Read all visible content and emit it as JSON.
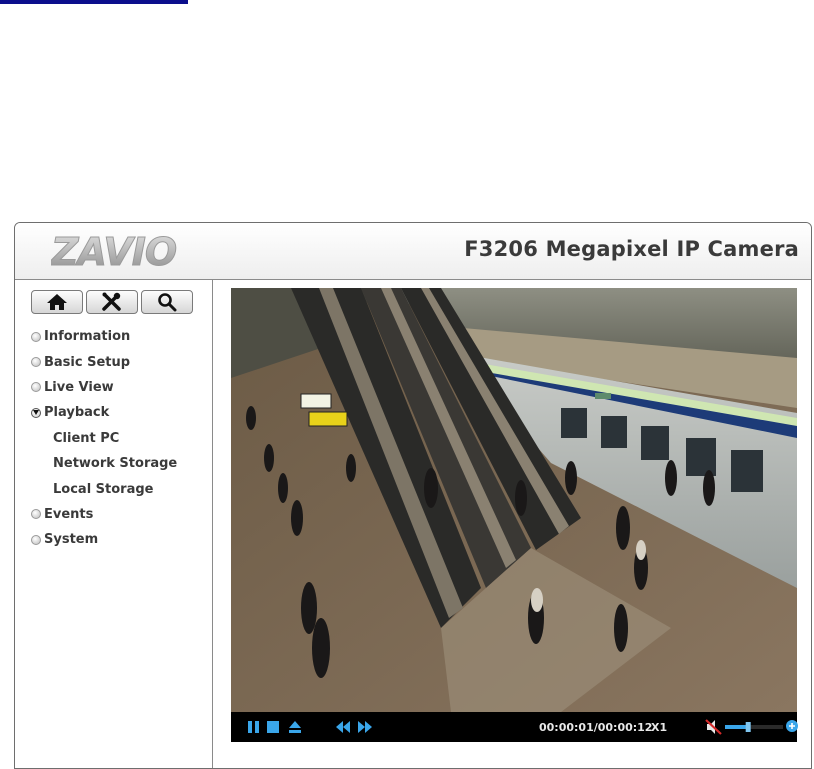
{
  "header": {
    "logo_text": "ZAVIO",
    "product_title": "F3206 Megapixel IP Camera"
  },
  "toolbar": {
    "buttons": [
      {
        "icon": "home-icon"
      },
      {
        "icon": "tools-icon"
      },
      {
        "icon": "search-icon"
      }
    ]
  },
  "menu": {
    "items": [
      {
        "label": "Information",
        "state": "closed"
      },
      {
        "label": "Basic Setup",
        "state": "closed"
      },
      {
        "label": "Live View",
        "state": "closed"
      },
      {
        "label": "Playback",
        "state": "open"
      },
      {
        "label": "Events",
        "state": "closed"
      },
      {
        "label": "System",
        "state": "closed"
      }
    ],
    "playback_sub": [
      "Client PC",
      "Network Storage",
      "Local Storage"
    ]
  },
  "player": {
    "timecode": "00:00:01/00:00:12",
    "speed": "X1",
    "volume_level": 0.4,
    "muted": true
  },
  "colors": {
    "top_link_bar": "#0b0e8c",
    "title_text": "#3a3a3a",
    "control_icons": "#3aa6ea"
  }
}
